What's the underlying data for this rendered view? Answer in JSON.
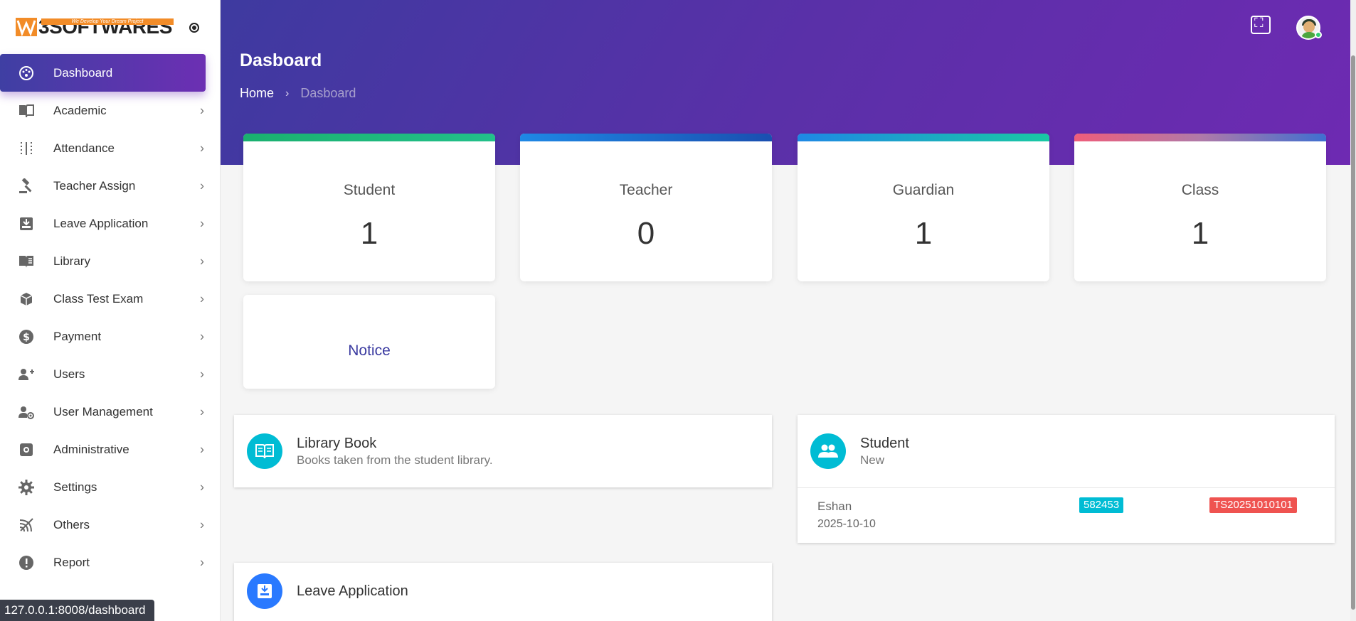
{
  "brand": {
    "name": "3SOFTWARES",
    "tagline": "We Develop Your Dream Project"
  },
  "sidebar": {
    "items": [
      {
        "label": "Dashboard",
        "icon": "dashboard-icon",
        "active": true
      },
      {
        "label": "Academic",
        "icon": "book-icon"
      },
      {
        "label": "Attendance",
        "icon": "attendance-icon"
      },
      {
        "label": "Teacher Assign",
        "icon": "gavel-icon"
      },
      {
        "label": "Leave Application",
        "icon": "inbox-icon"
      },
      {
        "label": "Library",
        "icon": "library-icon"
      },
      {
        "label": "Class Test Exam",
        "icon": "cube-icon"
      },
      {
        "label": "Payment",
        "icon": "dollar-icon"
      },
      {
        "label": "Users",
        "icon": "add-user-icon"
      },
      {
        "label": "User Management",
        "icon": "user-gear-icon"
      },
      {
        "label": "Administrative",
        "icon": "admin-icon"
      },
      {
        "label": "Settings",
        "icon": "gear-icon"
      },
      {
        "label": "Others",
        "icon": "signal-icon"
      },
      {
        "label": "Report",
        "icon": "alert-icon"
      }
    ]
  },
  "header": {
    "title": "Dasboard",
    "breadcrumb": {
      "home": "Home",
      "current": "Dasboard"
    }
  },
  "stats": [
    {
      "label": "Student",
      "value": "1",
      "accent": "#22c08a"
    },
    {
      "label": "Teacher",
      "value": "0",
      "accent": "#1565c0"
    },
    {
      "label": "Guardian",
      "value": "1",
      "accent": "#19c9a3"
    },
    {
      "label": "Class",
      "value": "1",
      "accent": "#ef5d7a"
    }
  ],
  "notice": {
    "label": "Notice"
  },
  "library_panel": {
    "title": "Library Book",
    "subtitle": "Books taken from the student library."
  },
  "student_panel": {
    "title": "Student",
    "subtitle": "New",
    "rows": [
      {
        "name": "Eshan",
        "date": "2025-10-10",
        "code": "582453",
        "id": "TS20251010101"
      }
    ]
  },
  "leave_panel": {
    "title": "Leave Application"
  },
  "status_url": "127.0.0.1:8008/dashboard",
  "colors": {
    "primary": "#4a35a6",
    "teal": "#00bcd4",
    "red": "#ef5350",
    "blue": "#2979ff"
  }
}
